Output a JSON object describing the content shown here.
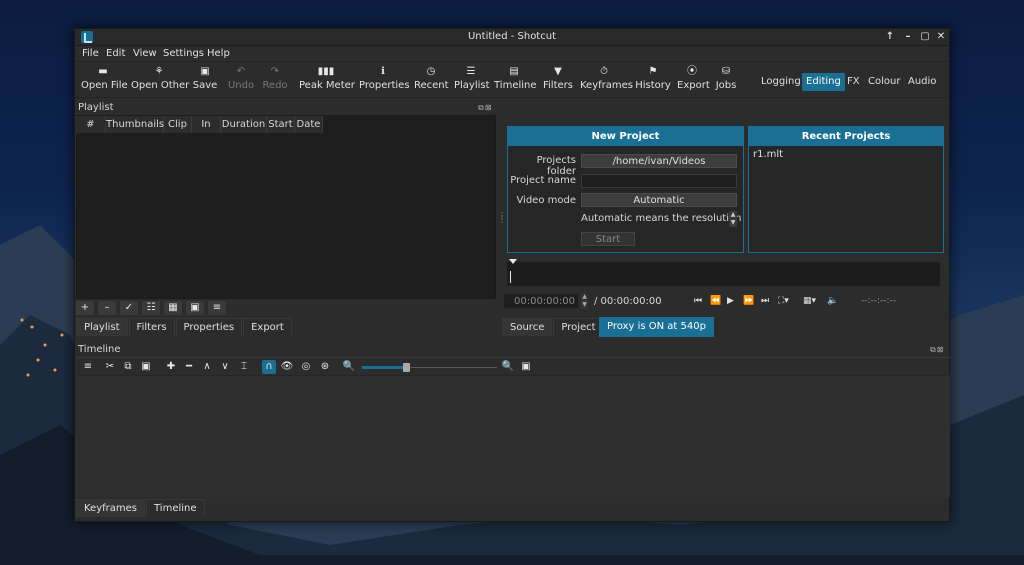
{
  "window": {
    "title": "Untitled - Shotcut",
    "controls": [
      "↑",
      "–",
      "▢",
      "✕"
    ]
  },
  "menu": [
    "File",
    "Edit",
    "View",
    "Settings",
    "Help"
  ],
  "toolbar": [
    {
      "label": "Open File",
      "icon": "▬"
    },
    {
      "label": "Open Other",
      "icon": "⚘"
    },
    {
      "label": "Save",
      "icon": "▣"
    },
    {
      "label": "Undo",
      "icon": "↶"
    },
    {
      "label": "Redo",
      "icon": "↷"
    },
    {
      "label": "Peak Meter",
      "icon": "▮▮▮"
    },
    {
      "label": "Properties",
      "icon": "ℹ"
    },
    {
      "label": "Recent",
      "icon": "◷"
    },
    {
      "label": "Playlist",
      "icon": "☰"
    },
    {
      "label": "Timeline",
      "icon": "▤"
    },
    {
      "label": "Filters",
      "icon": "▼"
    },
    {
      "label": "Keyframes",
      "icon": "⏱"
    },
    {
      "label": "History",
      "icon": "⚑"
    },
    {
      "label": "Export",
      "icon": "⦿"
    },
    {
      "label": "Jobs",
      "icon": "⛁"
    }
  ],
  "layouts": [
    "Logging",
    "Editing",
    "FX",
    "Colour",
    "Audio"
  ],
  "playlist": {
    "title": "Playlist",
    "columns": [
      "#",
      "Thumbnails",
      "Clip",
      "In",
      "Duration",
      "Start",
      "Date"
    ],
    "tools": [
      "+",
      "–",
      "✓",
      "☷",
      "▦",
      "▣",
      "≡"
    ],
    "tabs": [
      "Playlist",
      "Filters",
      "Properties",
      "Export"
    ]
  },
  "new_project": {
    "title": "New Project",
    "folder_label": "Projects folder",
    "folder_value": "/home/ivan/Videos",
    "name_label": "Project name",
    "name_value": "",
    "mode_label": "Video mode",
    "mode_value": "Automatic",
    "note": "Automatic means the resolution",
    "start_label": "Start"
  },
  "recent_projects": {
    "title": "Recent Projects",
    "items": [
      "r1.mlt"
    ]
  },
  "player": {
    "current_tc": "00:00:00:00",
    "total_tc": "/ 00:00:00:00",
    "inout_tc": "--:--:--:--",
    "source_tab": "Source",
    "project_tab": "Project",
    "proxy_label": "Proxy is ON at 540p"
  },
  "timeline": {
    "title": "Timeline"
  },
  "bottom_tabs": [
    "Keyframes",
    "Timeline"
  ],
  "colors": {
    "accent": "#1a6f95",
    "panel": "#2c2c2c",
    "dark": "#1e1e1e"
  }
}
